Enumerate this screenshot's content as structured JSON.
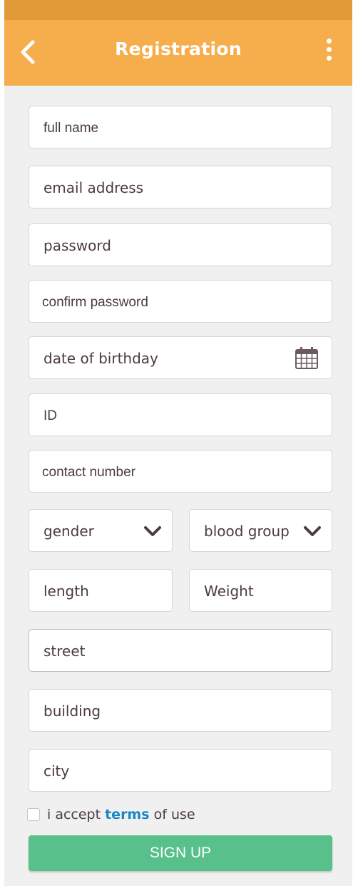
{
  "header": {
    "title": "Registration",
    "back_icon": "chevron-left-icon",
    "menu_icon": "more-vertical-icon",
    "background": "#f5ae4b",
    "status_bar_color": "#e09a37"
  },
  "form": {
    "full_name": "full name",
    "email": "email address",
    "password": "password",
    "confirm_password": "confirm password",
    "date_of_birthday": "date of birthday",
    "date_icon": "calendar-icon",
    "id": "ID",
    "contact_number": "contact number",
    "gender": "gender",
    "blood_group": "blood group",
    "dropdown_icon": "chevron-down-icon",
    "length": "length",
    "weight": "Weight",
    "street": "street",
    "building": "building",
    "city": "city"
  },
  "terms": {
    "prefix": "i accept ",
    "link": "terms",
    "suffix": " of use",
    "checked": false,
    "link_color": "#1a86c4"
  },
  "submit": {
    "label": "SIGN UP",
    "color": "#58c08a"
  }
}
